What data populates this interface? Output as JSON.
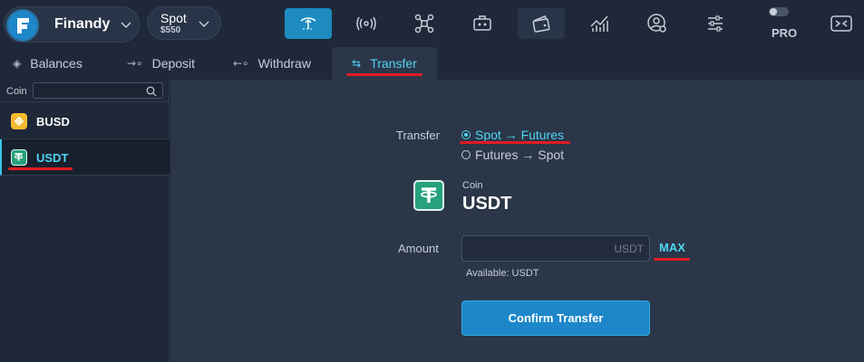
{
  "brand": {
    "name": "Finandy",
    "logo_letter": "F"
  },
  "account": {
    "name": "Spot",
    "balance": "$550"
  },
  "top_nav": [
    {
      "icon": "terminal-icon",
      "active": true
    },
    {
      "icon": "signal-icon",
      "active": false
    },
    {
      "icon": "network-icon",
      "active": false
    },
    {
      "icon": "bot-icon",
      "active": false
    },
    {
      "icon": "wallet-icon",
      "active": false
    },
    {
      "icon": "chart-icon",
      "active": false
    },
    {
      "icon": "user-settings-icon",
      "active": false
    },
    {
      "icon": "sliders-icon",
      "active": false
    }
  ],
  "pro": {
    "label": "PRO"
  },
  "tabs": [
    {
      "label": "Balances",
      "icon": "wallet-icon"
    },
    {
      "label": "Deposit",
      "icon": "deposit-icon"
    },
    {
      "label": "Withdraw",
      "icon": "withdraw-icon"
    },
    {
      "label": "Transfer",
      "icon": "transfer-icon",
      "active": true
    }
  ],
  "sidebar": {
    "header_label": "Coin",
    "search_placeholder": "",
    "coins": [
      {
        "symbol": "BUSD",
        "selected": false
      },
      {
        "symbol": "USDT",
        "selected": true
      }
    ]
  },
  "transfer": {
    "label": "Transfer",
    "options": [
      {
        "label": "Spot → Futures",
        "selected": true
      },
      {
        "label": "Futures → Spot",
        "selected": false
      }
    ],
    "coin_caption": "Coin",
    "coin": "USDT",
    "amount_label": "Amount",
    "amount_value": "",
    "amount_unit": "USDT",
    "max_label": "MAX",
    "available": "Available: USDT",
    "confirm_label": "Confirm Transfer"
  },
  "colors": {
    "accent": "#4fd5f1",
    "primary_button": "#1d87c9",
    "highlight_underline": "#e01c24",
    "tether_green": "#26a17b"
  }
}
